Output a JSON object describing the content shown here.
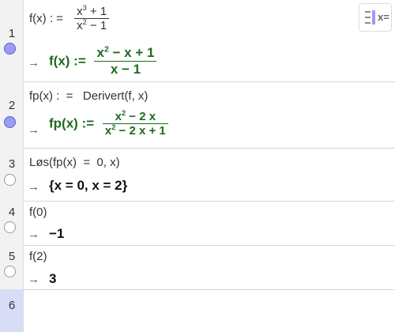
{
  "rows": [
    {
      "number": "1",
      "input_prefix": "f(x) :  =",
      "input_num": "x",
      "input_num_sup": "3",
      "input_num_rest": " + 1",
      "input_den": "x",
      "input_den_sup": "2",
      "input_den_rest": " − 1",
      "output_prefix": "f(x) :=",
      "output_num": "x",
      "output_num_sup": "2",
      "output_num_rest": " − x + 1",
      "output_den": "x − 1",
      "visible": true
    },
    {
      "number": "2",
      "input": "fp(x) :  =   Derivert(f, x)",
      "output_prefix": "fp(x) :=",
      "output_num": "x",
      "output_num_sup": "2",
      "output_num_rest": " − 2 x",
      "output_den": "x",
      "output_den_sup": "2",
      "output_den_rest": " − 2 x + 1",
      "visible": true
    },
    {
      "number": "3",
      "input": "Løs(fp(x)  =  0, x)",
      "output": "{x = 0, x = 2}",
      "visible": false
    },
    {
      "number": "4",
      "input": "f(0)",
      "output": "−1",
      "visible": false
    },
    {
      "number": "5",
      "input": "f(2)",
      "output": "3",
      "visible": false
    },
    {
      "number": "6",
      "input": ""
    }
  ],
  "arrow_glyph": "→",
  "toolbar": {
    "toggle_label": "x="
  },
  "colors": {
    "definition_output": "#1e6b1e",
    "active_row": "#d8dcf7"
  }
}
